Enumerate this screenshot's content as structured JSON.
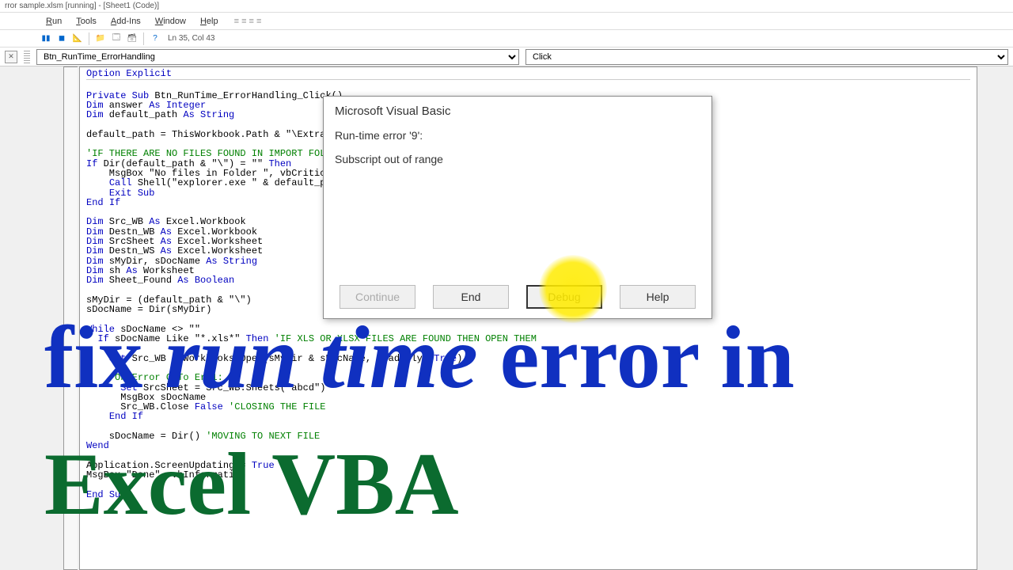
{
  "window": {
    "title": "rror sample.xlsm [running] - [Sheet1 (Code)]"
  },
  "menu": {
    "items": [
      {
        "label": "Run",
        "accel": "R"
      },
      {
        "label": "Tools",
        "accel": "T"
      },
      {
        "label": "Add-Ins",
        "accel": "A"
      },
      {
        "label": "Window",
        "accel": "W"
      },
      {
        "label": "Help",
        "accel": "H"
      }
    ]
  },
  "toolbar": {
    "status": "Ln 35, Col 43"
  },
  "dropdowns": {
    "object": "Btn_RunTime_ErrorHandling",
    "procedure": "Click"
  },
  "code": {
    "option": "Option Explicit",
    "lines": [
      "",
      "Private Sub Btn_RunTime_ErrorHandling_Click()",
      "Dim answer As Integer",
      "Dim default_path As String",
      "",
      "default_path = ThisWorkbook.Path & \"\\Extract\"",
      "",
      "'IF THERE ARE NO FILES FOUND IN IMPORT FOLDER",
      "If Dir(default_path & \"\\\") = \"\" Then",
      "    MsgBox \"No files in Folder \", vbCritical",
      "    Call Shell(\"explorer.exe \" & default_path",
      "    Exit Sub",
      "End If",
      "",
      "Dim Src_WB As Excel.Workbook",
      "Dim Destn_WB As Excel.Workbook",
      "Dim SrcSheet As Excel.Worksheet",
      "Dim Destn_WS As Excel.Worksheet",
      "Dim sMyDir, sDocName As String",
      "Dim sh As Worksheet",
      "Dim Sheet_Found As Boolean",
      "",
      "sMyDir = (default_path & \"\\\")",
      "sDocName = Dir(sMyDir)",
      "",
      "While sDocName <> \"\"",
      "  If sDocName Like \"*.xls*\" Then 'IF XLS OR XLSX FILES ARE FOUND THEN OPEN THEM",
      "",
      "    Set Src_WB = Workbooks.Open(sMyDir & sDocName, ReadOnly:=True)",
      "",
      "    'On Error GoTo Err1:",
      "      Set SrcSheet = Src_WB.Sheets(\"abcd\")",
      "      MsgBox sDocName",
      "      Src_WB.Close False 'CLOSING THE FILE",
      "    End If",
      "",
      "    sDocName = Dir() 'MOVING TO NEXT FILE",
      "Wend",
      "",
      "Application.ScreenUpdating = True",
      "MsgBox \"Done\", vbInformation",
      "",
      "End Sub"
    ]
  },
  "dialog": {
    "title": "Microsoft Visual Basic",
    "error_header": "Run-time error '9':",
    "error_message": "Subscript out of range",
    "buttons": {
      "continue": "Continue",
      "end": "End",
      "debug": "Debug",
      "help": "Help"
    }
  },
  "overlay": {
    "line1a": "fix ",
    "line1b": "run time",
    "line1c": " error in",
    "line2": "Excel VBA"
  }
}
